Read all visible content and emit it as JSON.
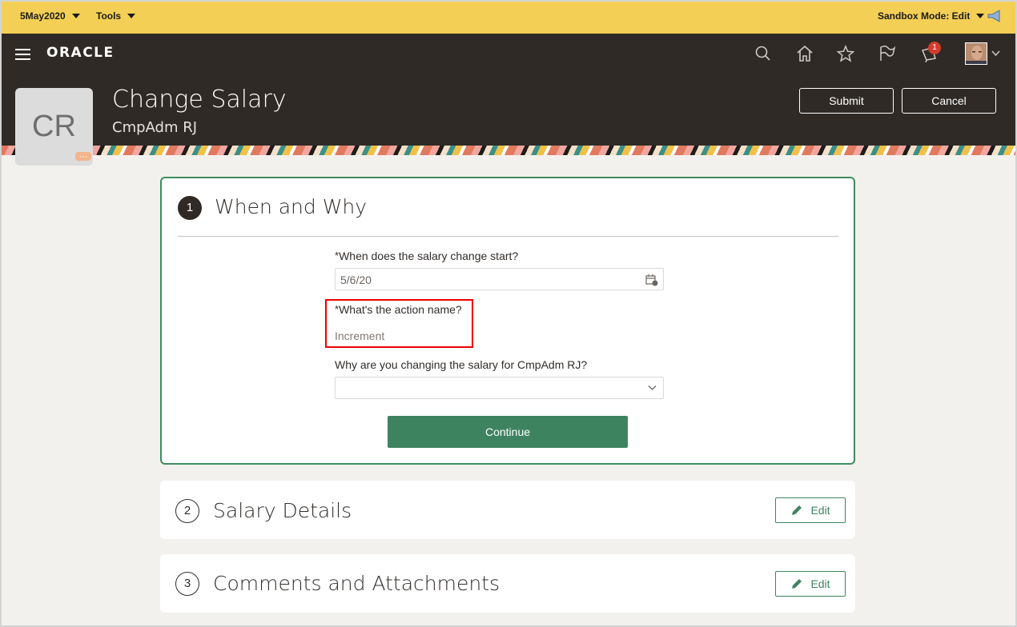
{
  "sandbox_bar": {
    "date_label": "5May2020",
    "tools_label": "Tools",
    "mode_label": "Sandbox Mode: Edit"
  },
  "header": {
    "logo": "ORACLE",
    "notification_count": "1",
    "initials": "CR",
    "title": "Change Salary",
    "subtitle": "CmpAdm RJ",
    "submit_label": "Submit",
    "cancel_label": "Cancel"
  },
  "steps": [
    {
      "number": "1",
      "title": "When and Why",
      "fields": {
        "start_label": "When does the salary change start?",
        "start_value": "5/6/20",
        "action_label": "What's the action name?",
        "action_value": "Increment",
        "reason_label": "Why are you changing the salary for CmpAdm RJ?",
        "reason_value": ""
      },
      "continue_label": "Continue"
    },
    {
      "number": "2",
      "title": "Salary Details",
      "edit_label": "Edit"
    },
    {
      "number": "3",
      "title": "Comments and Attachments",
      "edit_label": "Edit"
    }
  ],
  "required_marker": "*",
  "colors": {
    "sandbox_bar": "#f4cf55",
    "header_bg": "#2f2a26",
    "accent_green": "#3e8360",
    "highlight_red": "#e00000"
  },
  "icons": [
    "caret-down-icon",
    "megaphone-icon",
    "menu-icon",
    "search-icon",
    "home-icon",
    "star-icon",
    "flag-icon",
    "notifications-icon",
    "calendar-icon",
    "chevron-down-icon",
    "pencil-icon"
  ]
}
